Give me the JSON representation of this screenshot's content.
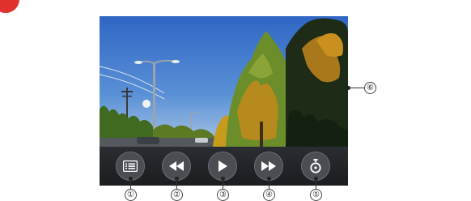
{
  "screen": {
    "controls": [
      {
        "id": "menu",
        "icon": "list-icon",
        "callout": "①"
      },
      {
        "id": "rewind",
        "icon": "rewind-icon",
        "callout": "②"
      },
      {
        "id": "play",
        "icon": "play-icon",
        "callout": "③"
      },
      {
        "id": "fast-forward",
        "icon": "fast-forward-icon",
        "callout": "④"
      },
      {
        "id": "timer",
        "icon": "stopwatch-icon",
        "callout": "⑤"
      }
    ],
    "video_callout": "⑥"
  },
  "colors": {
    "accent_marker": "#e0312d",
    "control_bar": "#1d1f22",
    "button_face": "#4a4d52",
    "icon": "#ffffff"
  }
}
